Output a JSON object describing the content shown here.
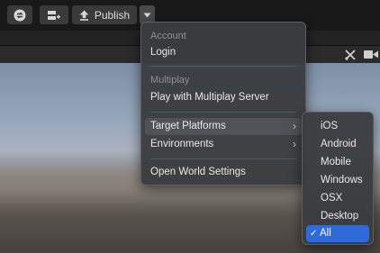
{
  "toolbar": {
    "publish_label": "Publish"
  },
  "menu": {
    "account_title": "Account",
    "login_label": "Login",
    "multiplay_title": "Multiplay",
    "play_multiplay_label": "Play with Multiplay Server",
    "target_platforms_label": "Target Platforms",
    "environments_label": "Environments",
    "open_world_label": "Open World Settings"
  },
  "submenu": {
    "items": [
      "iOS",
      "Android",
      "Mobile",
      "Windows",
      "OSX",
      "Desktop",
      "All"
    ],
    "selected": "All",
    "check_glyph": "✓"
  }
}
